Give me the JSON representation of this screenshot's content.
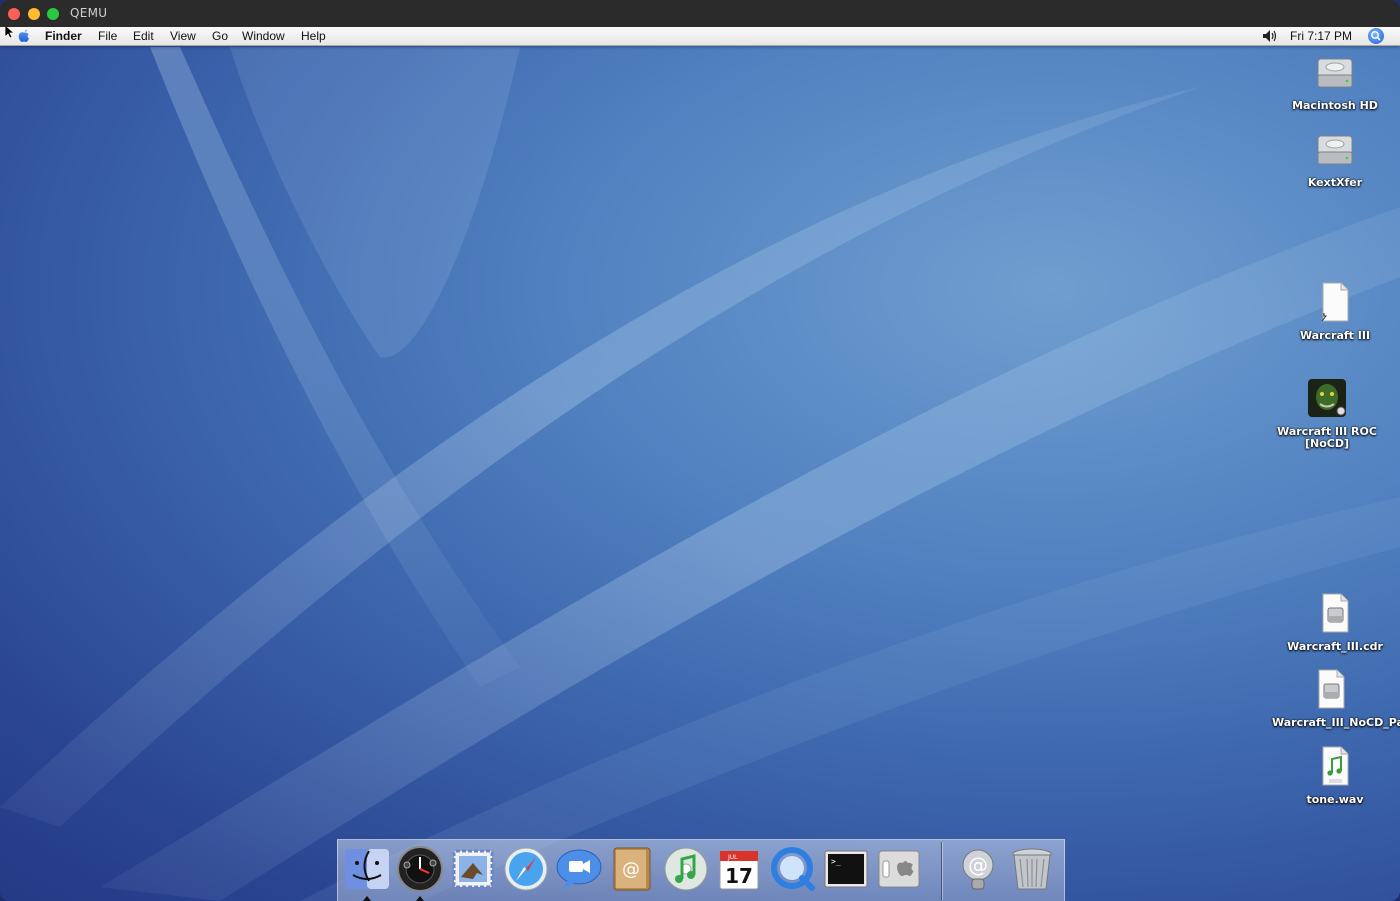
{
  "window": {
    "title": "QEMU"
  },
  "menubar": {
    "app_name": "Finder",
    "items": [
      "File",
      "Edit",
      "View",
      "Go",
      "Window",
      "Help"
    ],
    "clock": "Fri 7:17 PM"
  },
  "desktop_icons": [
    {
      "label": "Macintosh HD",
      "icon": "hard-disk-icon"
    },
    {
      "label": "KextXfer",
      "icon": "hard-disk-icon"
    },
    {
      "label": "Warcraft III",
      "icon": "document-alias-icon"
    },
    {
      "label": "Warcraft III ROC [NoCD]",
      "icon": "warcraft-app-icon"
    },
    {
      "label": "Warcraft_III.cdr",
      "icon": "disk-image-icon"
    },
    {
      "label": "Warcraft_III_NoCD_Pack.dmg",
      "icon": "disk-image-icon"
    },
    {
      "label": "tone.wav",
      "icon": "audio-file-icon"
    }
  ],
  "dock": {
    "apps": [
      {
        "name": "Finder",
        "icon": "finder-icon",
        "running": true
      },
      {
        "name": "Dashboard",
        "icon": "dashboard-icon",
        "running": true
      },
      {
        "name": "Mail",
        "icon": "mail-icon",
        "running": false
      },
      {
        "name": "Safari",
        "icon": "safari-icon",
        "running": false
      },
      {
        "name": "iChat",
        "icon": "ichat-icon",
        "running": false
      },
      {
        "name": "Address Book",
        "icon": "address-book-icon",
        "running": false
      },
      {
        "name": "iTunes",
        "icon": "itunes-icon",
        "running": false
      },
      {
        "name": "iCal",
        "icon": "ical-icon",
        "running": false,
        "badge": "17",
        "month": "JUL"
      },
      {
        "name": "QuickTime Player",
        "icon": "quicktime-icon",
        "running": false
      },
      {
        "name": "Terminal",
        "icon": "terminal-icon",
        "running": false
      },
      {
        "name": "System Preferences",
        "icon": "system-preferences-icon",
        "running": false
      }
    ],
    "others": [
      {
        "name": "Mail Downloads",
        "icon": "at-sign-icon"
      },
      {
        "name": "Trash",
        "icon": "trash-icon"
      }
    ]
  }
}
